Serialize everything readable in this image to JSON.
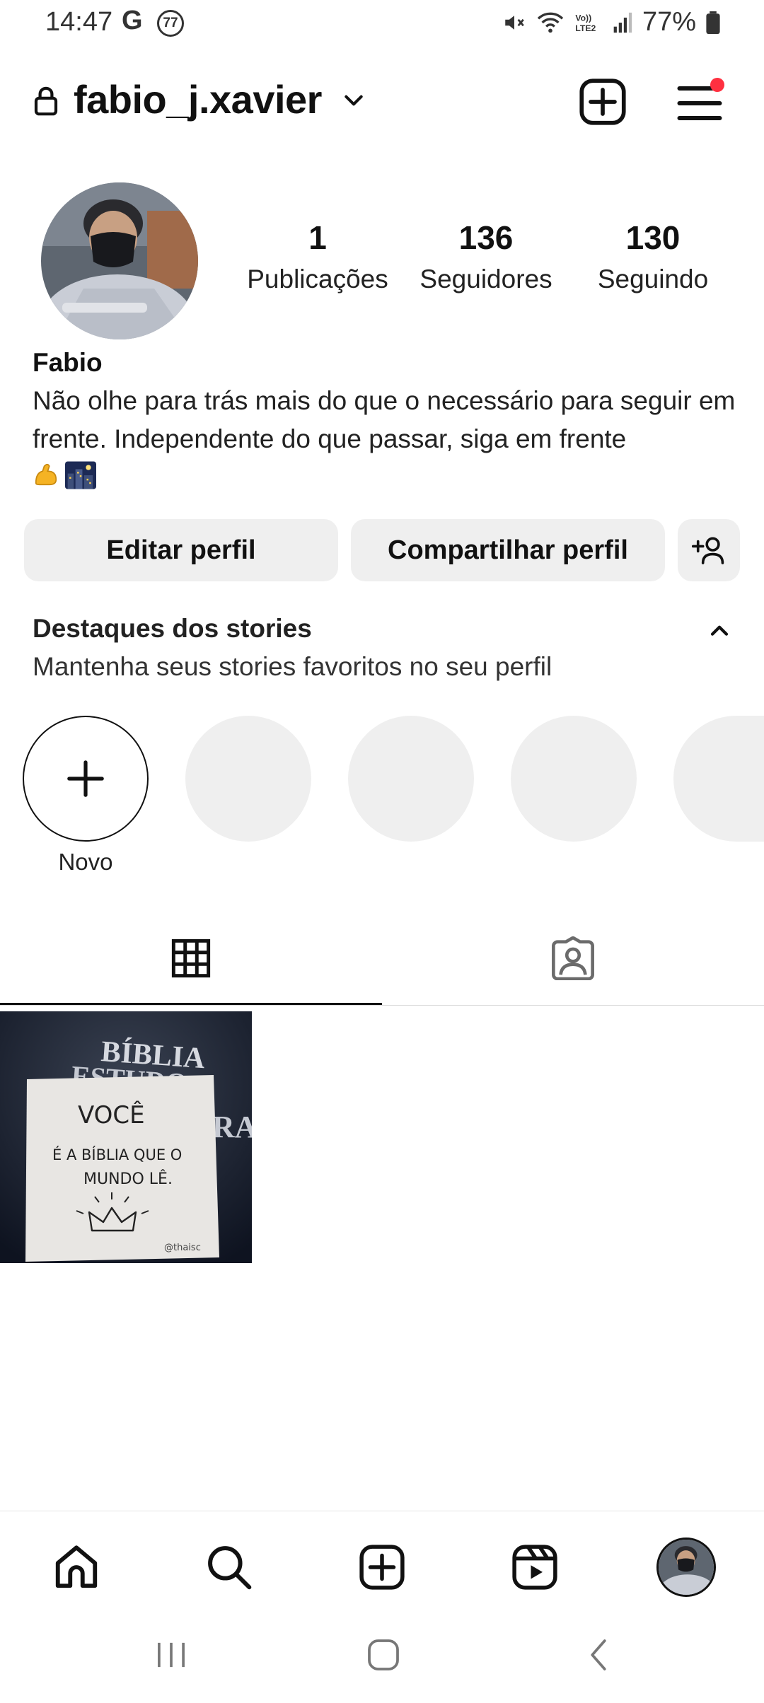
{
  "status_bar": {
    "time": "14:47",
    "google_glyph": "G",
    "notification_badge": "77",
    "battery_text": "77%"
  },
  "header": {
    "username": "fabio_j.xavier"
  },
  "profile": {
    "stats": [
      {
        "value": "1",
        "label": "Publicações"
      },
      {
        "value": "136",
        "label": "Seguidores"
      },
      {
        "value": "130",
        "label": "Seguindo"
      }
    ],
    "name": "Fabio",
    "bio": "Não olhe para trás mais do que o necessário para seguir em frente. Independente do que passar, siga em frente"
  },
  "actions": {
    "edit_label": "Editar perfil",
    "share_label": "Compartilhar perfil"
  },
  "highlights": {
    "title": "Destaques dos stories",
    "subtitle": "Mantenha seus stories favoritos no seu perfil",
    "new_label": "Novo",
    "empty_slots": 4
  },
  "post": {
    "book_text_line1": "BÍBLIA",
    "book_text_line2": "ESTUDO",
    "book_text_side": "RA",
    "note_line1": "VOCÊ",
    "note_line2": "É A BÍBLIA QUE O",
    "note_line3": "MUNDO LÊ.",
    "note_signature": "@thaisc"
  },
  "icons": {
    "lock": "lock-icon",
    "chevron": "chevron-down-icon",
    "new_post": "plus-square-icon",
    "menu": "hamburger-menu-icon",
    "grid": "grid-icon",
    "tagged": "tagged-person-icon",
    "home": "home-icon",
    "search": "search-icon",
    "create": "plus-square-icon",
    "reels": "reels-icon"
  },
  "colors": {
    "notification_dot": "#ff3040",
    "button_bg": "#efefef",
    "text": "#111111"
  }
}
